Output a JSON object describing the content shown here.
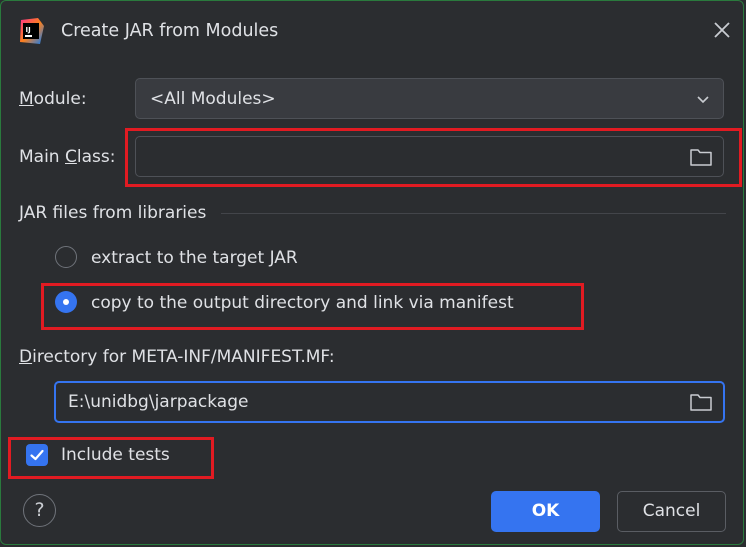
{
  "window": {
    "title": "Create JAR from Modules",
    "app_icon": "intellij-idea-icon",
    "close_icon": "close-icon"
  },
  "module": {
    "label_prefix": "",
    "label_mnemonic": "M",
    "label_rest": "odule:",
    "selected": "<All Modules>"
  },
  "main_class": {
    "label_prefix": "Main ",
    "label_mnemonic": "C",
    "label_rest": "lass:",
    "value": ""
  },
  "jar_libraries": {
    "section_label": "JAR files from libraries",
    "options": [
      {
        "label": "extract to the target JAR",
        "selected": false
      },
      {
        "label": "copy to the output directory and link via manifest",
        "selected": true
      }
    ]
  },
  "manifest_dir": {
    "label_mnemonic": "D",
    "label_rest": "irectory for META-INF/MANIFEST.MF:",
    "value": "E:\\unidbg\\jarpackage"
  },
  "include_tests": {
    "label": "Include tests",
    "checked": true
  },
  "footer": {
    "help_label": "?",
    "ok_label": "OK",
    "cancel_label": "Cancel"
  },
  "colors": {
    "accent": "#3574f0",
    "highlight_box": "#e11b22",
    "background": "#2b2d30"
  }
}
